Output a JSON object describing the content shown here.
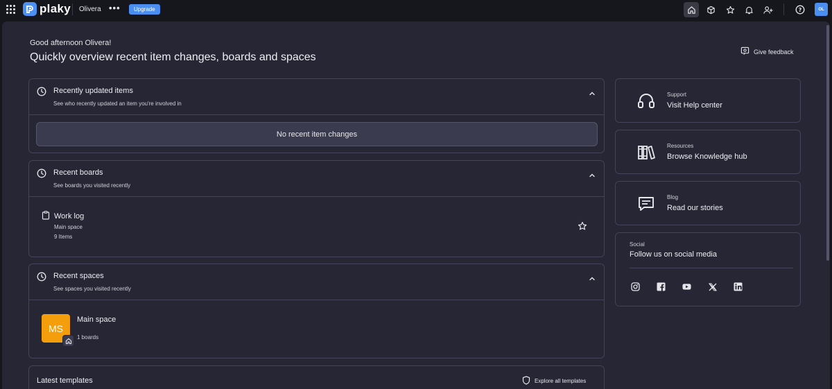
{
  "topbar": {
    "logo_text": "plaky",
    "workspace": "Olivera",
    "more": "•••",
    "upgrade_label": "Upgrade",
    "avatar_initials": "OL",
    "icons": [
      "home-icon",
      "cube-icon",
      "star-icon",
      "bell-icon",
      "add-user-icon",
      "help-icon"
    ]
  },
  "header": {
    "greeting": "Good afternoon Olivera!",
    "headline": "Quickly overview recent item changes, boards and spaces",
    "feedback_label": "Give feedback"
  },
  "recent_items": {
    "title": "Recently updated items",
    "subtitle": "See who recently updated an item you're involved in",
    "empty_text": "No recent item changes"
  },
  "recent_boards": {
    "title": "Recent boards",
    "subtitle": "See boards you visited recently",
    "items": [
      {
        "name": "Work log",
        "space": "Main space",
        "count": "9 Items"
      }
    ]
  },
  "recent_spaces": {
    "title": "Recent spaces",
    "subtitle": "See spaces you visited recently",
    "items": [
      {
        "initials": "MS",
        "name": "Main space",
        "count": "1 boards",
        "color": "#f59e0b"
      }
    ]
  },
  "templates": {
    "title": "Latest templates",
    "explore_label": "Explore all templates"
  },
  "sidebar": {
    "support": {
      "label": "Support",
      "text": "Visit Help center",
      "icon": "headphones-icon"
    },
    "resources": {
      "label": "Resources",
      "text": "Browse Knowledge hub",
      "icon": "books-icon"
    },
    "blog": {
      "label": "Blog",
      "text": "Read our stories",
      "icon": "chat-icon"
    },
    "social": {
      "label": "Social",
      "text": "Follow us on social media",
      "icons": [
        "instagram-icon",
        "facebook-icon",
        "youtube-icon",
        "x-icon",
        "linkedin-icon"
      ]
    }
  },
  "colors": {
    "accent": "#4a8ef2",
    "background": "#16161d",
    "panel": "#262635",
    "border": "#43435a"
  }
}
